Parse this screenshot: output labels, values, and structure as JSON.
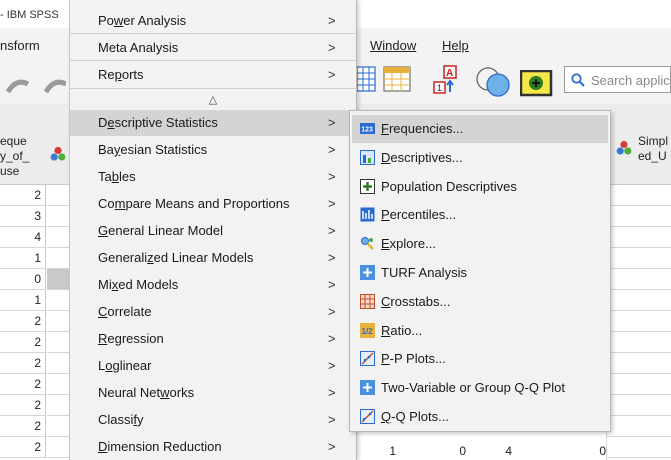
{
  "window": {
    "title_fragment": "- IBM SPSS"
  },
  "menubar": {
    "transform_fragment": "nsform",
    "window": "Window",
    "help": "Help"
  },
  "search": {
    "placeholder": "Search applic"
  },
  "grid": {
    "left_header": [
      "eque",
      "y_of_",
      "use"
    ],
    "right_header": [
      "Simpl",
      "ed_U"
    ],
    "rows": [
      "2",
      "3",
      "4",
      "1",
      "0",
      "1",
      "2",
      "2",
      "2",
      "2",
      "2",
      "2",
      "2"
    ],
    "bottom_row": [
      "1",
      "0",
      "4",
      "0"
    ]
  },
  "analyze_menu": {
    "items": [
      {
        "pre": "Po",
        "u": "w",
        "post": "er Analysis"
      },
      {
        "pre": "Meta Analysis",
        "u": "",
        "post": ""
      },
      {
        "pre": "Re",
        "u": "p",
        "post": "orts"
      },
      {
        "pre": "D",
        "u": "e",
        "post": "scriptive Statistics"
      },
      {
        "pre": "Ba",
        "u": "y",
        "post": "esian Statistics"
      },
      {
        "pre": "Ta",
        "u": "b",
        "post": "les"
      },
      {
        "pre": "Co",
        "u": "m",
        "post": "pare Means and Proportions"
      },
      {
        "pre": "",
        "u": "G",
        "post": "eneral Linear Model"
      },
      {
        "pre": "Generali",
        "u": "z",
        "post": "ed Linear Models"
      },
      {
        "pre": "Mi",
        "u": "x",
        "post": "ed Models"
      },
      {
        "pre": "",
        "u": "C",
        "post": "orrelate"
      },
      {
        "pre": "",
        "u": "R",
        "post": "egression"
      },
      {
        "pre": "L",
        "u": "o",
        "post": "glinear"
      },
      {
        "pre": "Neural Net",
        "u": "w",
        "post": "orks"
      },
      {
        "pre": "Classi",
        "u": "f",
        "post": "y"
      },
      {
        "pre": "",
        "u": "D",
        "post": "imension Reduction"
      }
    ],
    "arrow": ">",
    "scroll_up": "△"
  },
  "descriptive_submenu": {
    "items": [
      {
        "pre": "",
        "u": "F",
        "post": "requencies...",
        "icon": "frequencies-icon"
      },
      {
        "pre": "",
        "u": "D",
        "post": "escriptives...",
        "icon": "descriptives-icon"
      },
      {
        "pre": "Population Descriptives",
        "u": "",
        "post": "",
        "icon": "population-descriptives-icon"
      },
      {
        "pre": "",
        "u": "P",
        "post": "ercentiles...",
        "icon": "percentiles-icon"
      },
      {
        "pre": "",
        "u": "E",
        "post": "xplore...",
        "icon": "explore-icon"
      },
      {
        "pre": "TURF Analysis",
        "u": "",
        "post": "",
        "icon": "turf-icon"
      },
      {
        "pre": "",
        "u": "C",
        "post": "rosstabs...",
        "icon": "crosstabs-icon"
      },
      {
        "pre": "",
        "u": "R",
        "post": "atio...",
        "icon": "ratio-icon"
      },
      {
        "pre": "",
        "u": "P",
        "post": "-P Plots...",
        "icon": "pp-plots-icon"
      },
      {
        "pre": "Two-Variable or Group Q-Q Plot",
        "u": "",
        "post": "",
        "icon": "qq-group-icon"
      },
      {
        "pre": "",
        "u": "Q",
        "post": "-Q Plots...",
        "icon": "qq-plots-icon"
      }
    ]
  }
}
